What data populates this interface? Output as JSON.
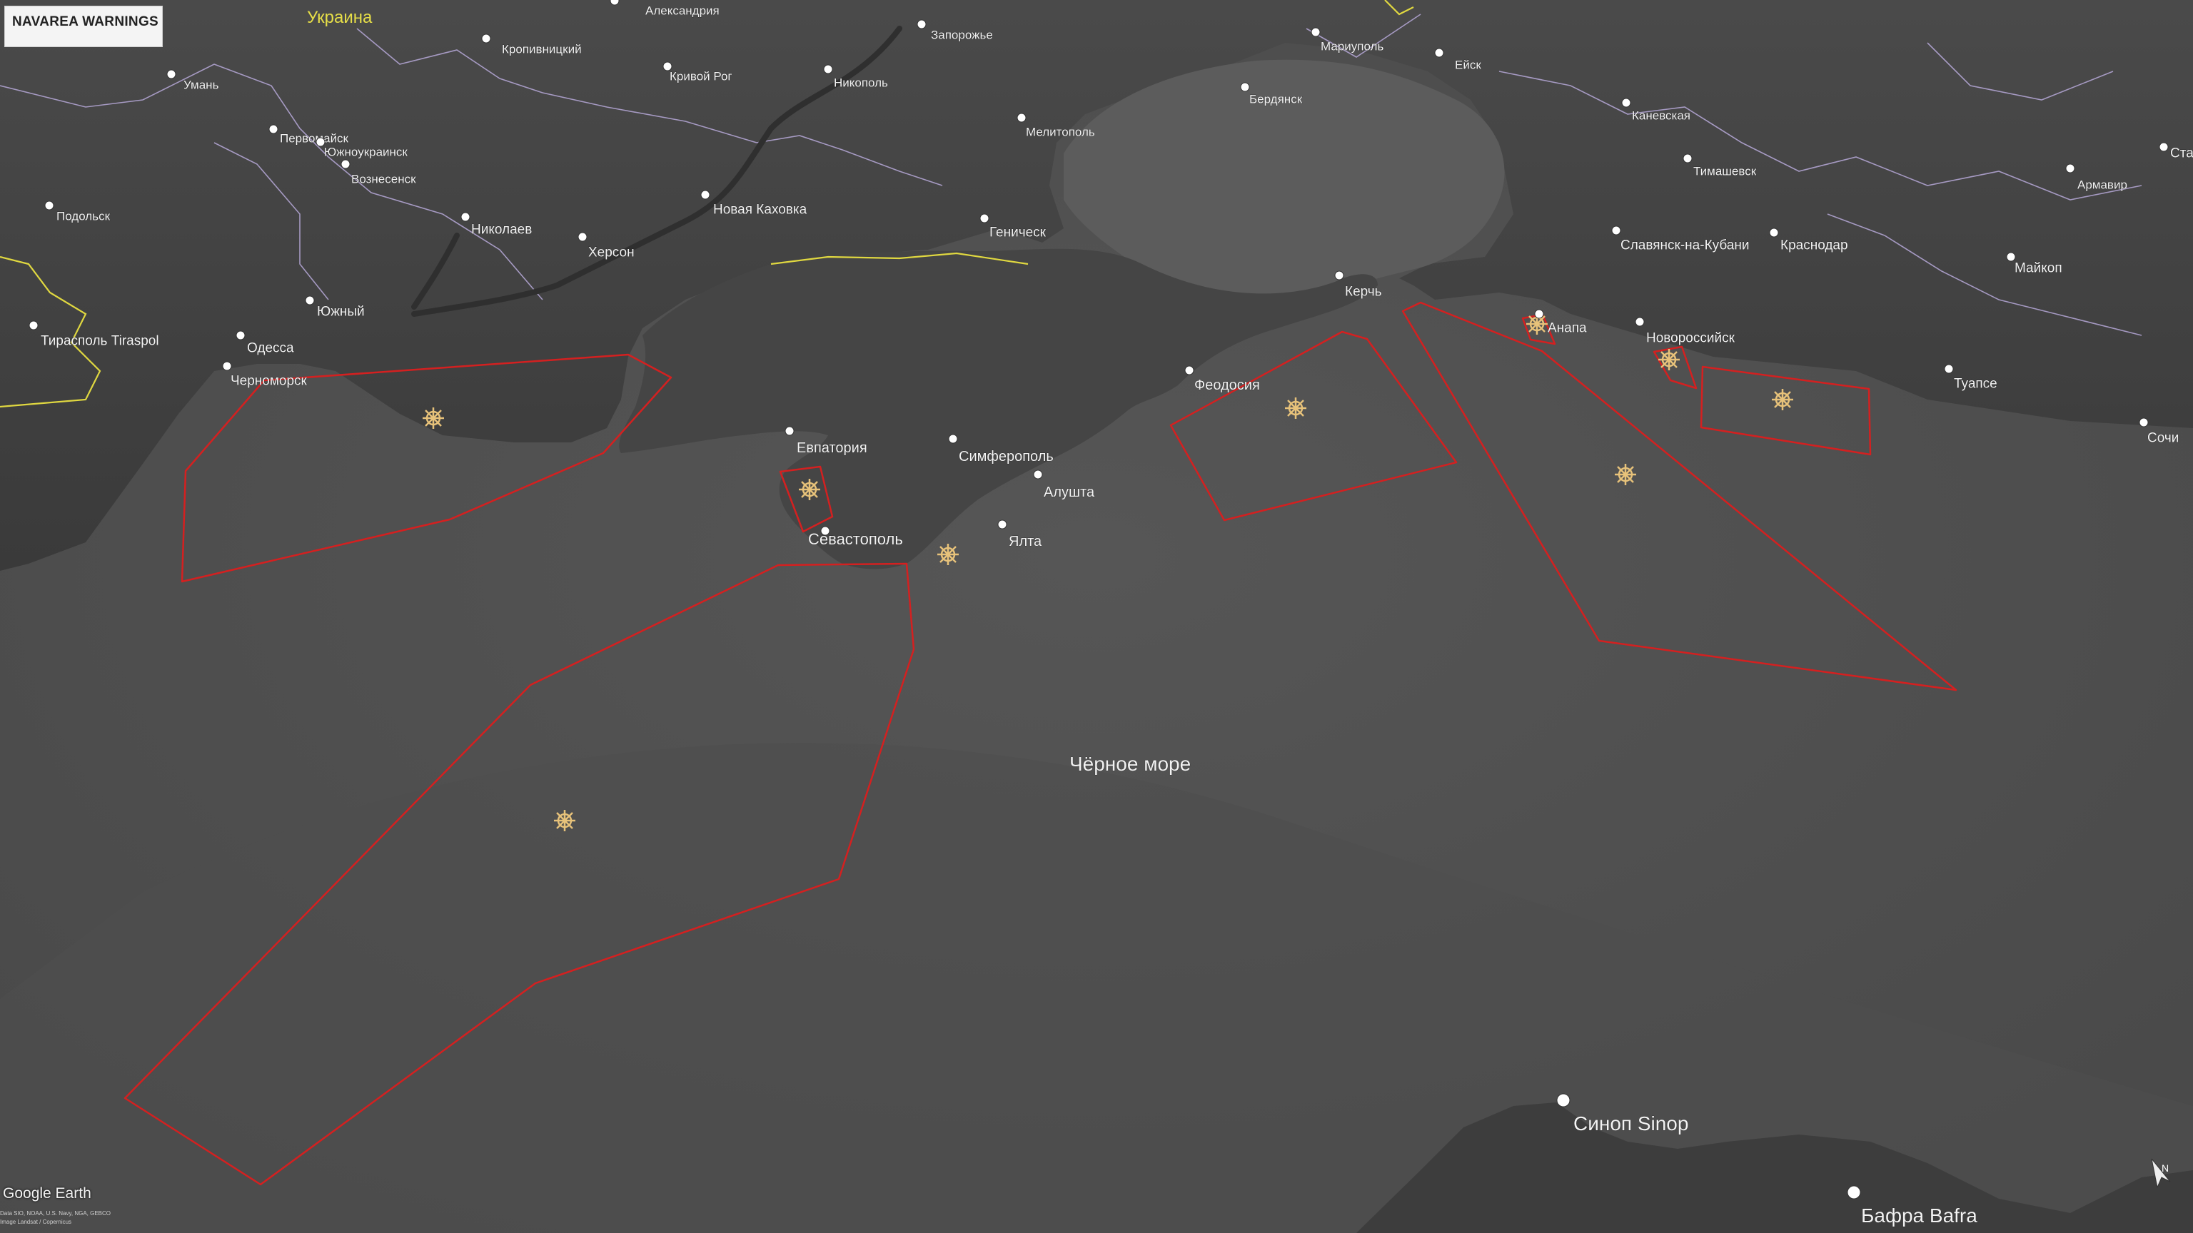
{
  "title_panel": "NAVAREA WARNINGS",
  "brand": "Google Earth",
  "credits": [
    "Data SIO, NOAA, U.S. Navy, NGA, GEBCO",
    "Image Landsat / Copernicus"
  ],
  "sea_label": "Чёрное море",
  "region_label": "Украина",
  "cities": [
    {
      "name": "Александрия"
    },
    {
      "name": "Кропивницкий"
    },
    {
      "name": "Запорожье"
    },
    {
      "name": "Мариуполь"
    },
    {
      "name": "Ейск"
    },
    {
      "name": "Умань"
    },
    {
      "name": "Кривой Рог"
    },
    {
      "name": "Никополь"
    },
    {
      "name": "Бердянск"
    },
    {
      "name": "Каневская"
    },
    {
      "name": "Первомайск"
    },
    {
      "name": "Южноукраинск"
    },
    {
      "name": "Мелитополь"
    },
    {
      "name": "Тимашевск"
    },
    {
      "name": "Армавир"
    },
    {
      "name": "Вознесенск"
    },
    {
      "name": "Подольск"
    },
    {
      "name": "Новая Каховка"
    },
    {
      "name": "Николаев"
    },
    {
      "name": "Геническ"
    },
    {
      "name": "Славянск-на-Кубани"
    },
    {
      "name": "Краснодар"
    },
    {
      "name": "Майкоп"
    },
    {
      "name": "Херсон"
    },
    {
      "name": "Керчь"
    },
    {
      "name": "Южный"
    },
    {
      "name": "Анапа"
    },
    {
      "name": "Новороссийск"
    },
    {
      "name": "Тирасполь Tiraspol"
    },
    {
      "name": "Одесса"
    },
    {
      "name": "Феодосия"
    },
    {
      "name": "Туапсе"
    },
    {
      "name": "Черноморск"
    },
    {
      "name": "Сочи"
    },
    {
      "name": "Евпатория"
    },
    {
      "name": "Симферополь"
    },
    {
      "name": "Алушта"
    },
    {
      "name": "Ялта"
    },
    {
      "name": "Севастополь"
    },
    {
      "name": "Синоп Sinop"
    },
    {
      "name": "Бафра Bafra"
    },
    {
      "name": "Ста"
    }
  ],
  "warning_zones": [
    "west-nw",
    "sevastopol-small",
    "southwest-large",
    "feodosia",
    "kerch-south",
    "anapa-small",
    "novorossiysk-small",
    "novorossiysk-east"
  ],
  "colors": {
    "zone": "#d42020",
    "sea": "#555555",
    "land": "#3f3f3f",
    "border": "#b7a9d9",
    "border_ua": "#e0d840"
  }
}
